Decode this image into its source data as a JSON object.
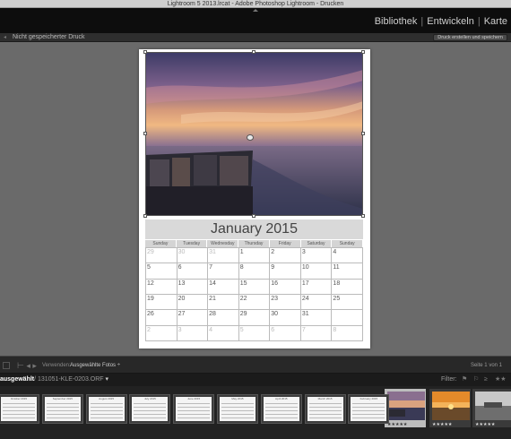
{
  "window": {
    "title": "Lightroom 5 2013.lrcat - Adobe Photoshop Lightroom - Drucken"
  },
  "modules": [
    "Bibliothek",
    "Entwickeln",
    "Karte"
  ],
  "subbar": {
    "doc_title": "Nicht gespeicherter Druck",
    "save_button": "Druck erstellen und speichern"
  },
  "calendar": {
    "month_title": "January 2015",
    "weekdays": [
      "Sunday",
      "Tuesday",
      "Wednesday",
      "Thursday",
      "Friday",
      "Saturday",
      "Sunday"
    ],
    "days": [
      [
        "29",
        "30",
        "31",
        "1",
        "2",
        "3",
        "4"
      ],
      [
        "5",
        "6",
        "7",
        "8",
        "9",
        "10",
        "11"
      ],
      [
        "12",
        "13",
        "14",
        "15",
        "16",
        "17",
        "18"
      ],
      [
        "19",
        "20",
        "21",
        "22",
        "23",
        "24",
        "25"
      ],
      [
        "26",
        "27",
        "28",
        "29",
        "30",
        "31",
        ""
      ],
      [
        "2",
        "3",
        "4",
        "5",
        "6",
        "7",
        "8"
      ]
    ],
    "dim_days": [
      [
        0,
        0
      ],
      [
        0,
        1
      ],
      [
        0,
        2
      ],
      [
        5,
        0
      ],
      [
        5,
        1
      ],
      [
        5,
        2
      ],
      [
        5,
        3
      ],
      [
        5,
        4
      ],
      [
        5,
        5
      ],
      [
        5,
        6
      ]
    ]
  },
  "toolbar": {
    "use_label": "Verwenden:",
    "use_value": "Ausgewählte Fotos",
    "page_info": "Seite 1 von 1"
  },
  "filmstrip": {
    "source_prefix": "ausgewählt",
    "file_name": "/ 131051-KLE-0203.ORF",
    "filter_label": "Filter:",
    "calendar_thumbs": [
      "October 2015",
      "September 2015",
      "August 2015",
      "July 2015",
      "June 2015",
      "May 2015",
      "April 2015",
      "March 2015",
      "February 2015"
    ],
    "photo_thumbs": [
      {
        "rating": "★★★★★"
      },
      {
        "rating": "★★★★★"
      },
      {
        "rating": "★★★★★"
      }
    ]
  },
  "colors": {
    "accent": "#cfcfcf",
    "panel": "#282828",
    "canvas": "#6a6a6a"
  }
}
